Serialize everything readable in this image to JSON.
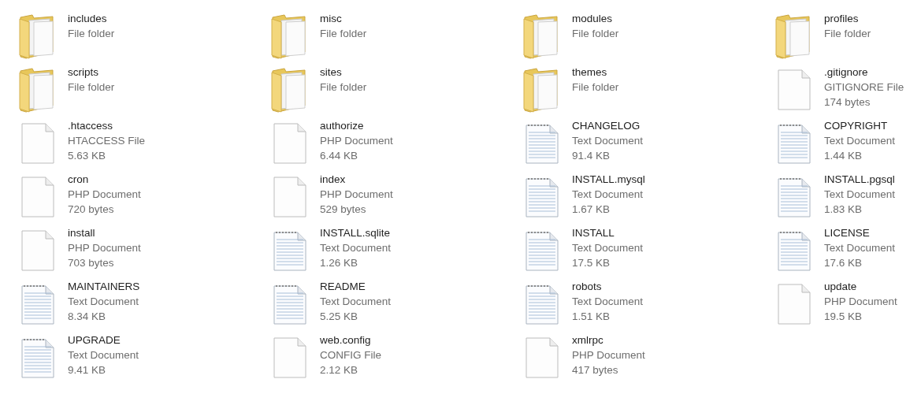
{
  "items": [
    {
      "name": "includes",
      "kind": "folder",
      "details": [
        "File folder"
      ]
    },
    {
      "name": "misc",
      "kind": "folder",
      "details": [
        "File folder"
      ]
    },
    {
      "name": "modules",
      "kind": "folder",
      "details": [
        "File folder"
      ]
    },
    {
      "name": "profiles",
      "kind": "folder",
      "details": [
        "File folder"
      ]
    },
    {
      "name": "scripts",
      "kind": "folder",
      "details": [
        "File folder"
      ]
    },
    {
      "name": "sites",
      "kind": "folder",
      "details": [
        "File folder"
      ]
    },
    {
      "name": "themes",
      "kind": "folder",
      "details": [
        "File folder"
      ]
    },
    {
      "name": ".gitignore",
      "kind": "blank",
      "details": [
        "GITIGNORE File",
        "174 bytes"
      ]
    },
    {
      "name": ".htaccess",
      "kind": "blank",
      "details": [
        "HTACCESS File",
        "5.63 KB"
      ]
    },
    {
      "name": "authorize",
      "kind": "blank",
      "details": [
        "PHP Document",
        "6.44 KB"
      ]
    },
    {
      "name": "CHANGELOG",
      "kind": "text",
      "details": [
        "Text Document",
        "91.4 KB"
      ]
    },
    {
      "name": "COPYRIGHT",
      "kind": "text",
      "details": [
        "Text Document",
        "1.44 KB"
      ]
    },
    {
      "name": "cron",
      "kind": "blank",
      "details": [
        "PHP Document",
        "720 bytes"
      ]
    },
    {
      "name": "index",
      "kind": "blank",
      "details": [
        "PHP Document",
        "529 bytes"
      ]
    },
    {
      "name": "INSTALL.mysql",
      "kind": "text",
      "details": [
        "Text Document",
        "1.67 KB"
      ]
    },
    {
      "name": "INSTALL.pgsql",
      "kind": "text",
      "details": [
        "Text Document",
        "1.83 KB"
      ]
    },
    {
      "name": "install",
      "kind": "blank",
      "details": [
        "PHP Document",
        "703 bytes"
      ]
    },
    {
      "name": "INSTALL.sqlite",
      "kind": "text",
      "details": [
        "Text Document",
        "1.26 KB"
      ]
    },
    {
      "name": "INSTALL",
      "kind": "text",
      "details": [
        "Text Document",
        "17.5 KB"
      ]
    },
    {
      "name": "LICENSE",
      "kind": "text",
      "details": [
        "Text Document",
        "17.6 KB"
      ]
    },
    {
      "name": "MAINTAINERS",
      "kind": "text",
      "details": [
        "Text Document",
        "8.34 KB"
      ]
    },
    {
      "name": "README",
      "kind": "text",
      "details": [
        "Text Document",
        "5.25 KB"
      ]
    },
    {
      "name": "robots",
      "kind": "text",
      "details": [
        "Text Document",
        "1.51 KB"
      ]
    },
    {
      "name": "update",
      "kind": "blank",
      "details": [
        "PHP Document",
        "19.5 KB"
      ]
    },
    {
      "name": "UPGRADE",
      "kind": "text",
      "details": [
        "Text Document",
        "9.41 KB"
      ]
    },
    {
      "name": "web.config",
      "kind": "blank",
      "details": [
        "CONFIG File",
        "2.12 KB"
      ]
    },
    {
      "name": "xmlrpc",
      "kind": "blank",
      "details": [
        "PHP Document",
        "417 bytes"
      ]
    }
  ]
}
